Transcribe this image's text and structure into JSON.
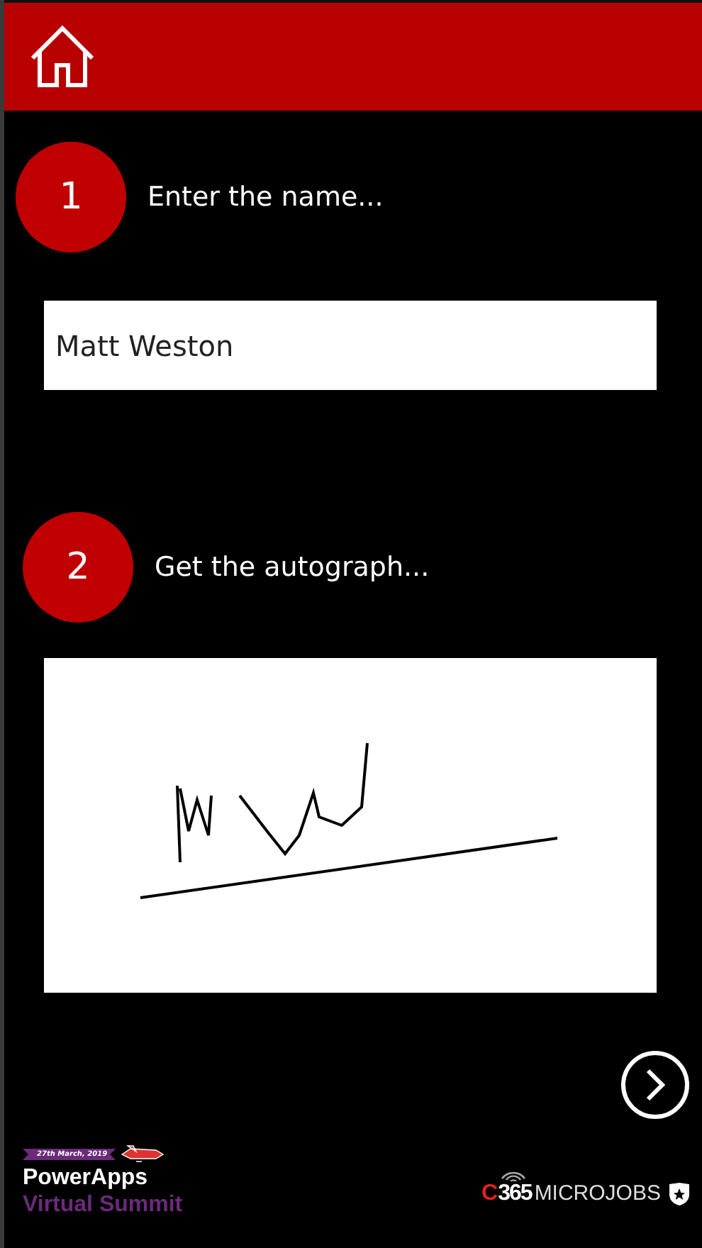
{
  "header": {
    "home": true
  },
  "steps": [
    {
      "number": "1",
      "label": "Enter the name...",
      "kind": "text",
      "value": "Matt Weston"
    },
    {
      "number": "2",
      "label": "Get the autograph...",
      "kind": "signature"
    }
  ],
  "footer": {
    "event": {
      "date": "27th March, 2019",
      "title": "PowerApps",
      "subtitle": "Virtual Summit"
    },
    "brand": {
      "prefix": "C",
      "number": "365",
      "word": "MICROJOBS"
    }
  }
}
